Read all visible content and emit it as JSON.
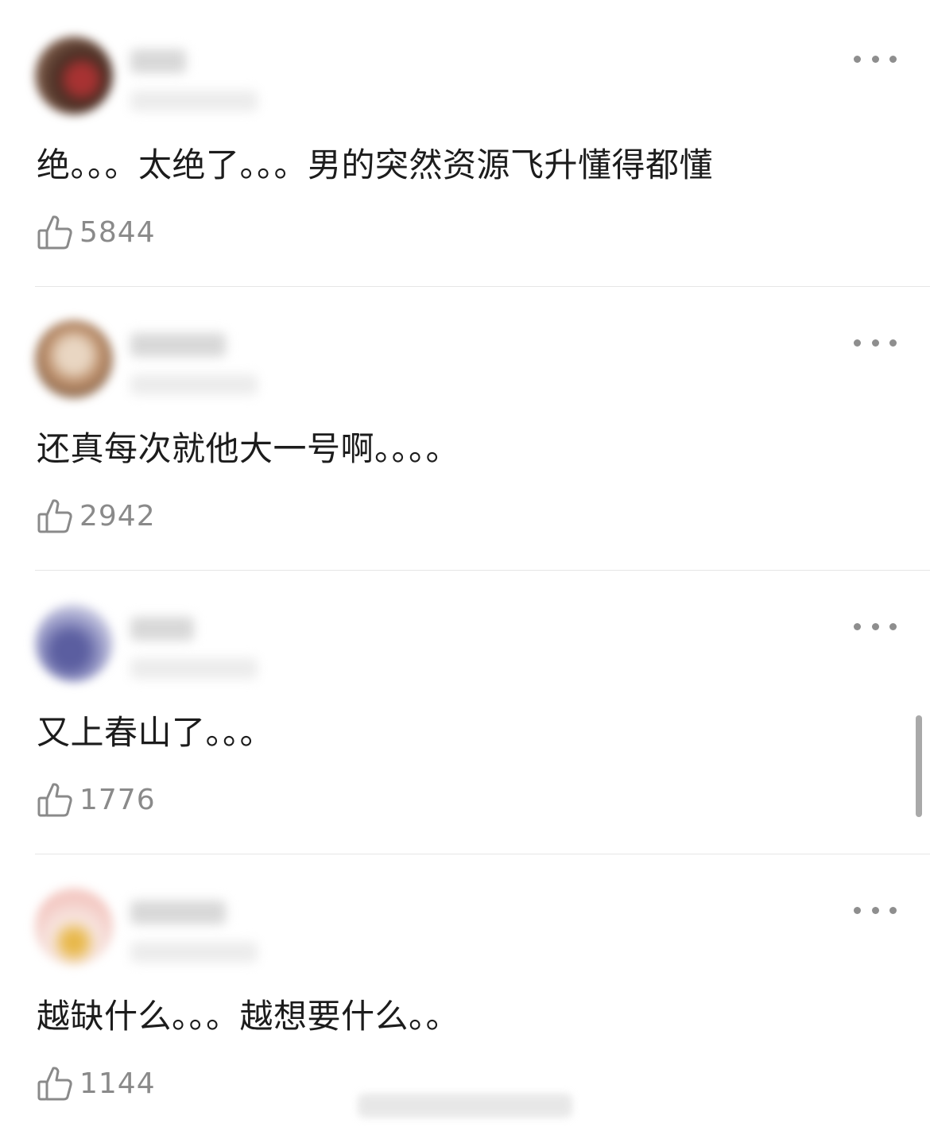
{
  "comments": [
    {
      "text": "绝。。。太绝了。。。男的突然资源飞升懂得都懂",
      "likes": "5844",
      "avatar_colors": [
        "#5a3a2e",
        "#a83232"
      ]
    },
    {
      "text": "还真每次就他大一号啊。。。。",
      "likes": "2942",
      "avatar_colors": [
        "#b88a66",
        "#e8d8c6"
      ]
    },
    {
      "text": "又上春山了。。。",
      "likes": "1776",
      "avatar_colors": [
        "#5b5ea0",
        "#c7c9e3"
      ]
    },
    {
      "text": "越缺什么。。。越想要什么。。",
      "likes": "1144",
      "avatar_colors": [
        "#f3c6c0",
        "#e8b84a"
      ]
    }
  ],
  "icons": {
    "more": "more-options-icon",
    "like": "thumbs-up-icon"
  }
}
